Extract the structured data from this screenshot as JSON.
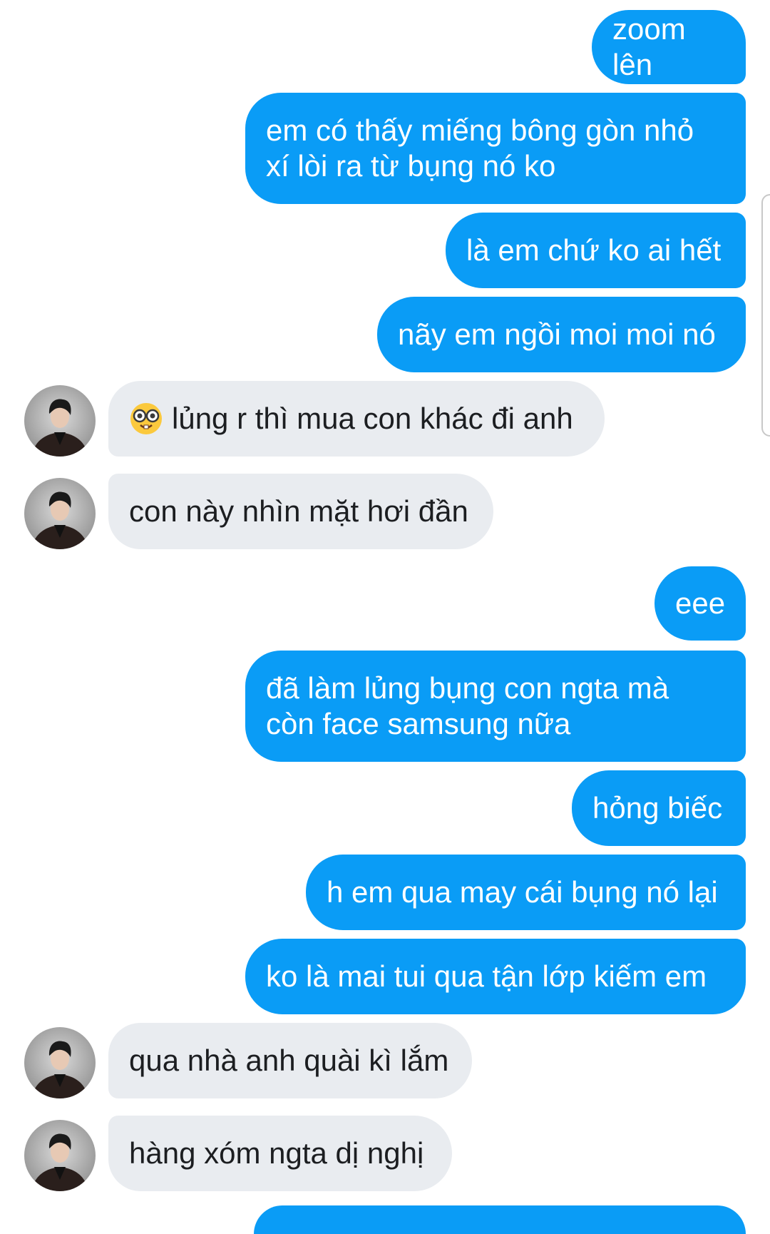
{
  "colors": {
    "outgoing_bubble": "#0a9cf6",
    "incoming_bubble": "#e9ecf0",
    "outgoing_text": "#ffffff",
    "incoming_text": "#1c1e21"
  },
  "messages": [
    {
      "direction": "out",
      "text": "zoom lên"
    },
    {
      "direction": "out",
      "text": "em có thấy miếng bông gòn nhỏ xí lòi ra từ bụng nó ko"
    },
    {
      "direction": "out",
      "text": "là em chứ ko ai hết"
    },
    {
      "direction": "out",
      "text": "nãy em ngồi moi moi nó"
    },
    {
      "direction": "in",
      "emoji": "nerd-face-icon",
      "text": "lủng r thì mua con khác đi anh"
    },
    {
      "direction": "in",
      "text": "con này nhìn mặt hơi đần"
    },
    {
      "direction": "out",
      "text": "eee"
    },
    {
      "direction": "out",
      "text": "đã làm lủng bụng con ngta mà còn face samsung nữa"
    },
    {
      "direction": "out",
      "text": "hỏng biếc"
    },
    {
      "direction": "out",
      "text": "h em qua may cái bụng nó lại"
    },
    {
      "direction": "out",
      "text": "ko là mai tui qua tận lớp kiếm em"
    },
    {
      "direction": "in",
      "text": "qua nhà anh quài kì lắm"
    },
    {
      "direction": "in",
      "text": "hàng xóm ngta dị nghị"
    }
  ]
}
